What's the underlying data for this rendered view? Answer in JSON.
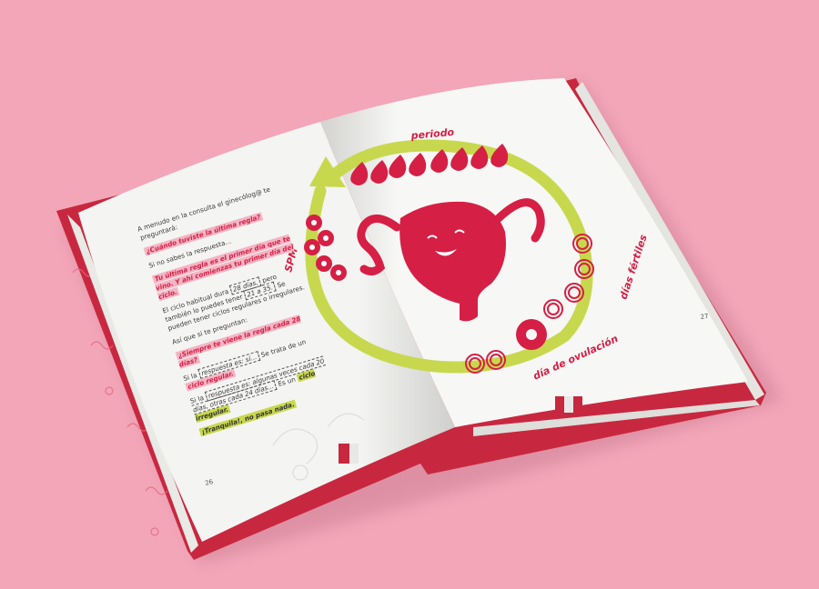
{
  "left_page": {
    "intro": "A menudo en la consulta el ginecólog@ te preguntará:",
    "q1": "¿Cuándo tuviste la última regla?",
    "no_sabes": "Si no sabes la respuesta...",
    "tip": "Tu última regla es el primer día que te vino. Y ahí comienzas tu primer día del ciclo.",
    "ciclo_dura_a": "El ciclo habitual dura",
    "ciclo_dura_days": "28 días,",
    "ciclo_dura_b": "pero también lo puedes tener",
    "ciclo_range": "21 a 35.",
    "ciclo_dura_c": "Se pueden tener ciclos regulares o irregulares.",
    "asi_que": "Así que si te preguntan:",
    "q2": "¿Siempre te viene la regla cada 28 días?",
    "si_resp_a": "Si la",
    "si_resp_b": "respuesta es: sí...",
    "se_trata_a": "Se trata de un",
    "se_trata_b": "ciclo regular.",
    "si_resp2_a": "Si la",
    "si_resp2_b": "respuesta es: algunas veces cada 20 días, otras cada 24 días...",
    "es_un_a": "Es un",
    "es_un_b": "ciclo irregular.",
    "tranquila": "¡Tranquila!, no pasa nada.",
    "page_number": "26"
  },
  "right_page": {
    "periodo": "periodo",
    "spm": "SPM",
    "dias_fertiles": "días fértiles",
    "dia_ovulacion": "día de ovulación",
    "page_number": "27"
  },
  "colors": {
    "background": "#f2a6b8",
    "accent_red": "#d61f45",
    "cycle_green": "#c8d84e",
    "cover_red": "#c8283f",
    "page": "#f7f7f5"
  },
  "icons": [
    "uterus-character-icon",
    "blood-drop-icon",
    "flower-icon",
    "ring-icon",
    "cycle-arrow-icon"
  ]
}
